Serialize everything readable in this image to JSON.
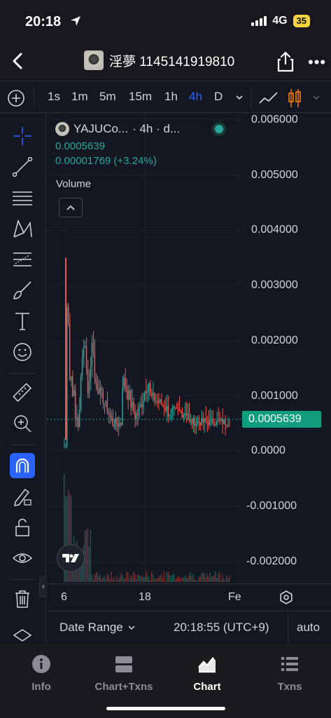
{
  "status": {
    "time": "20:18",
    "network": "4G",
    "battery": "35"
  },
  "nav": {
    "title": "淫夢 1145141919810"
  },
  "toolbar": {
    "intervals": [
      "1s",
      "1m",
      "5m",
      "15m",
      "1h",
      "4h",
      "D"
    ],
    "active_interval": "4h"
  },
  "legend": {
    "symbol": "YAJUCo...",
    "meta": "· 4h · d...",
    "price": "0.0005639",
    "change": "0.00001769 (+3.24%)",
    "volume_label": "Volume"
  },
  "yaxis": {
    "labels": [
      "0.006000",
      "0.005000",
      "0.004000",
      "0.003000",
      "0.002000",
      "0.001000",
      "0.0000",
      "-0.001000",
      "-0.002000"
    ],
    "last_price": "0.0005639"
  },
  "xaxis": {
    "labels": [
      "6",
      "18",
      "Fe"
    ]
  },
  "footer": {
    "date_range": "Date Range",
    "clock": "20:18:55 (UTC+9)",
    "scale": "auto"
  },
  "tabs": [
    {
      "label": "Info",
      "icon": "info-icon"
    },
    {
      "label": "Chart+Txns",
      "icon": "layout-icon"
    },
    {
      "label": "Chart",
      "icon": "chart-icon"
    },
    {
      "label": "Txns",
      "icon": "list-icon"
    }
  ],
  "active_tab": "Chart",
  "colors": {
    "up": "#26a69a",
    "down": "#ef5350",
    "accent": "#2962ff",
    "price_tag": "#0f9d7e"
  }
}
